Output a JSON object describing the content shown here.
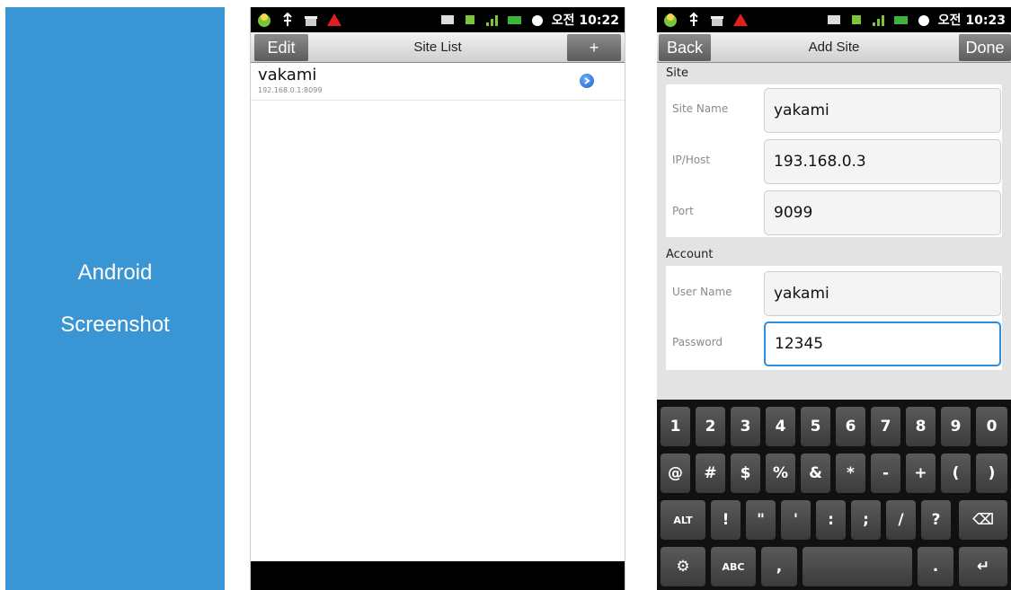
{
  "label_panel": {
    "line1": "Android",
    "line2": "Screenshot",
    "color": "#3a95d4"
  },
  "status_bar_1": {
    "time": "오전 10:22"
  },
  "status_bar_2": {
    "time": "오전 10:23"
  },
  "site_list": {
    "title": "Site List",
    "edit_label": "Edit",
    "add_label": "+",
    "sites": [
      {
        "name": "vakami",
        "address": "192.168.0.1:8099"
      }
    ]
  },
  "add_site": {
    "title": "Add Site",
    "back_label": "Back",
    "done_label": "Done",
    "site_section": "Site",
    "account_section": "Account",
    "fields": {
      "site_name": {
        "label": "Site Name",
        "value": "yakami"
      },
      "ip_host": {
        "label": "IP/Host",
        "value": "193.168.0.3"
      },
      "port": {
        "label": "Port",
        "value": "9099"
      },
      "user_name": {
        "label": "User Name",
        "value": "yakami"
      },
      "password": {
        "label": "Password",
        "value": "12345"
      }
    }
  },
  "keyboard": {
    "row1": [
      "1",
      "2",
      "3",
      "4",
      "5",
      "6",
      "7",
      "8",
      "9",
      "0"
    ],
    "row2": [
      "@",
      "#",
      "$",
      "%",
      "&",
      "*",
      "-",
      "+",
      "(",
      ")"
    ],
    "row3": [
      "ALT",
      "!",
      "\"",
      "'",
      ":",
      ";",
      "/",
      "?",
      "⌫"
    ],
    "row4": [
      "⚙",
      "ABC",
      ",",
      "",
      ".",
      "↵"
    ]
  },
  "accent_color": "#2a8fe0"
}
